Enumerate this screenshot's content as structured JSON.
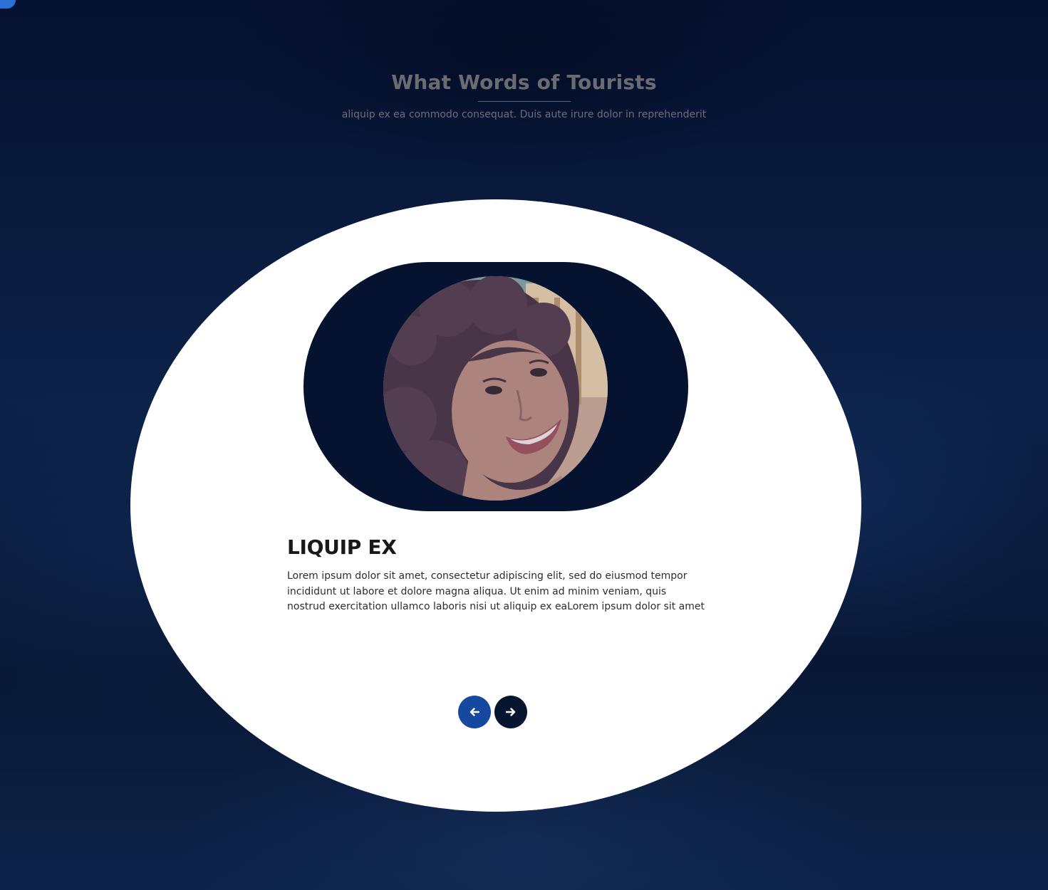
{
  "section": {
    "title": "What Words of Tourists",
    "subtitle": "aliquip ex ea commodo consequat. Duis aute irure dolor in reprehenderit"
  },
  "testimonial": {
    "name": "LIQUIP EX",
    "quote": "Lorem ipsum dolor sit amet, consectetur adipiscing elit, sed do eiusmod tempor incididunt ut labore et dolore magna aliqua. Ut enim ad minim veniam, quis nostrud exercitation ullamco laboris nisi ut aliquip ex eaLorem ipsum dolor sit amet",
    "avatar_icon": "person-photo"
  },
  "carousel": {
    "prev_icon": "arrow-left-icon",
    "next_icon": "arrow-right-icon"
  },
  "colors": {
    "background": "#0a1a36",
    "card": "#ffffff",
    "pill": "#051230",
    "prev_button": "#1648a0",
    "next_button": "#081530",
    "title": "#6a6c72"
  }
}
